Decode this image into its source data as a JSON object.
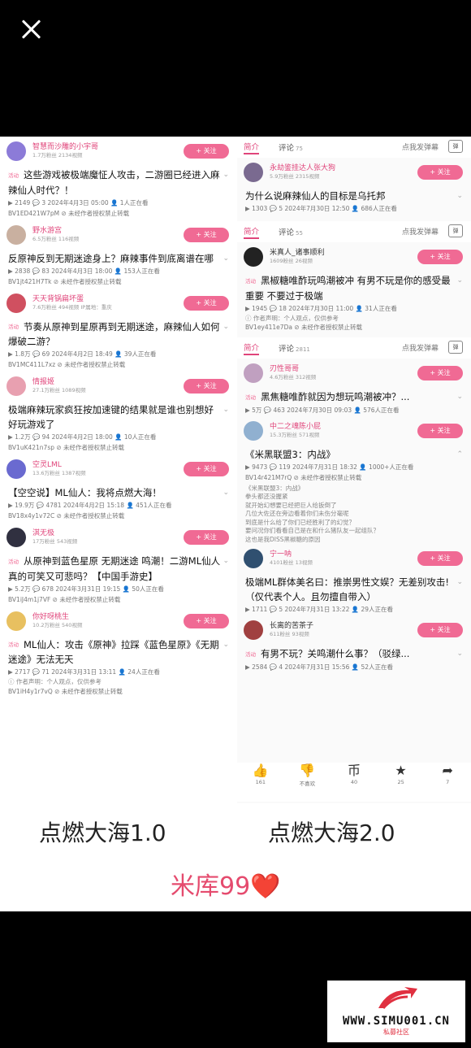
{
  "left": {
    "items": [
      {
        "author": "智慧而沙雕的小宇哥",
        "stat": "1.7万粉丝  2134视频",
        "follow": "+ 关注",
        "tag": "活动",
        "title": "这些游戏被极端魔怔人攻击，二游圈已经进入麻辣仙人时代？！",
        "meta": "▶ 2149  💬 3  2024年4月3日 05:00  👤 1人正在看",
        "bv": "BV1ED421W7pM  ⊘ 未经作者授权禁止转载",
        "avatar": "#8c7bd8"
      },
      {
        "author": "野水游宫",
        "stat": "6.5万粉丝  116视频",
        "follow": "+ 关注",
        "tag": "",
        "title": "反原神反到无期迷途身上？麻辣事件到底离谱在哪",
        "meta": "▶ 2838  💬 83  2024年4月3日 18:00  👤 153人正在看",
        "bv": "BV1jt421H7Tk  ⊘ 未经作者授权禁止转载",
        "avatar": "#c9b0a0"
      },
      {
        "author": "天天背锅扁坏蛋",
        "stat": "7.6万粉丝  494视频  IP属地：重庆",
        "follow": "+ 关注",
        "tag": "活动",
        "title": "节奏从原神到星原再到无期迷途，麻辣仙人如何爆破二游？",
        "meta": "▶ 1.8万  💬 69  2024年4月2日 18:49  👤 39人正在看",
        "bv": "BV1MC411L7xz  ⊘ 未经作者授权禁止转载",
        "avatar": "#d05060"
      },
      {
        "author": "情报姬",
        "stat": "27.1万粉丝  1089视频",
        "follow": "+ 关注",
        "tag": "",
        "title": "极端麻辣玩家疯狂按加速键的结果就是谁也别想好好玩游戏了",
        "meta": "▶ 1.2万  💬 94  2024年4月2日 18:00  👤 10人正在看",
        "bv": "BV1uK421n7sp  ⊘ 未经作者授权禁止转载",
        "avatar": "#e8a0b0"
      },
      {
        "author": "空灵LML",
        "stat": "13.6万粉丝  1387视频",
        "follow": "+ 关注",
        "tag": "",
        "title": "【空空说】ML仙人：我将点燃大海！",
        "meta": "▶ 19.9万  💬 4781  2024年4月2日 15:18  👤 451人正在看",
        "bv": "BV18x4y1v72C  ⊘ 未经作者授权禁止转载",
        "avatar": "#6a6ad0"
      },
      {
        "author": "淇无极",
        "stat": "17万粉丝  543视频",
        "follow": "+ 关注",
        "tag": "活动",
        "title": "从原神到蓝色星原 无期迷途 鸣潮！二游ML仙人真的可笑又可悲吗？【中国手游史】",
        "meta": "▶ 5.2万  💬 678  2024年3月31日 19:15  👤 50人正在看",
        "bv": "BV1iJ4m1j7VF  ⊘ 未经作者授权禁止转载",
        "avatar": "#303040"
      },
      {
        "author": "你好呀桃生",
        "stat": "10.2万粉丝  540视频",
        "follow": "+ 关注",
        "tag": "活动",
        "title": "ML仙人：攻击《原神》拉踩《蓝色星原》《无期迷途》无法无天",
        "meta": "▶ 2717  💬 71  2024年3月31日 13:11  👤 24人正在看",
        "desc": "ⓘ 作者声明：个人观点，仅供参考",
        "bv": "BV1iH4y1r7vQ  ⊘ 未经作者授权禁止转载",
        "avatar": "#e8c060"
      }
    ]
  },
  "right": {
    "tabs1": {
      "intro": "简介",
      "comments": "评论",
      "count": "75",
      "danmu": "点我发弹幕",
      "tv": "弹"
    },
    "item1": {
      "author": "永劫鉴挂达人张大狗",
      "stat": "5.9万粉丝  2315视频",
      "follow": "+ 关注",
      "title": "为什么说麻辣仙人的目标是乌托邦",
      "meta": "▶ 1303  💬 5  2024年7月30日 12:50  👤 686人正在看"
    },
    "tabs2": {
      "intro": "简介",
      "comments": "评论",
      "count": "55",
      "danmu": "点我发弹幕",
      "tv": "弹"
    },
    "item2": {
      "author": "米真人_诸事顺利",
      "stat": "1609粉丝  26视频",
      "follow": "+ 关注",
      "tag": "活动",
      "title": "黑椒糖唯酢玩鸣潮被冲 有男不玩是你的感受最重要 不要过于极端",
      "meta": "▶ 1945  💬 18  2024年7月30日 11:00  👤 31人正在看",
      "desc": "ⓘ 作者声明：个人观点，仅供参考",
      "bv": "BV1ey411e7Da  ⊘ 未经作者授权禁止转载"
    },
    "tabs3": {
      "intro": "简介",
      "comments": "评论",
      "count": "2811",
      "danmu": "点我发弹幕",
      "tv": "弹"
    },
    "item3": {
      "author": "刃性哥哥",
      "stat": "4.6万粉丝  312视频",
      "follow": "+ 关注",
      "tag": "活动",
      "title": "黑焦糖唯酢就因为想玩鸣潮被冲？...",
      "meta": "▶ 5万  💬 463  2024年7月30日 09:03  👤 576人正在看"
    },
    "item4": {
      "author": "中二之魂陈小屁",
      "stat": "15.3万粉丝  571视频",
      "follow": "+ 关注",
      "title": "《米黑联盟3：内战》",
      "meta": "▶ 9473  💬 119  2024年7月31日 18:32  👤 1000+人正在看",
      "bv": "BV14r421M7rQ  ⊘ 未经作者授权禁止转载",
      "desc": [
        "《米黑联盟3：内战》",
        "拳头都还没握紧",
        "就开始幻想要已经把巨人给扳倒了",
        "几位大佐还在旁边看着你们未伤分毫呢",
        "到底是什么给了你们已经胜利了的幻觉？",
        "要问况你们看看自己是在和什么猪队友一起组队？",
        "这也是我DISS黑椒糖的原因"
      ]
    },
    "item5": {
      "author": "宁一呐",
      "stat": "4101粉丝  13视频",
      "follow": "+ 关注",
      "title": "极端ML群体美名曰：推崇男性文娱？无差别攻击!（仅代表个人。且勿擅自带入）",
      "meta": "▶ 1711  💬 5  2024年7月31日 13:22  👤 29人正在看"
    },
    "item6": {
      "author": "长离的苦茶子",
      "stat": "611粉丝  93视频",
      "follow": "+ 关注",
      "tag": "活动",
      "title": "有男不玩？关鸣潮什么事？（驳绿...",
      "meta": "▶ 2584  💬 4  2024年7月31日 15:56  👤 52人正在看"
    },
    "actions": [
      {
        "icon": "👍",
        "label": "161"
      },
      {
        "icon": "👎",
        "label": "不喜欢"
      },
      {
        "icon": "币",
        "label": "40"
      },
      {
        "icon": "★",
        "label": "25"
      },
      {
        "icon": "➦",
        "label": "7"
      }
    ]
  },
  "captions": {
    "left": "点燃大海1.0",
    "right": "点燃大海2.0"
  },
  "brand": {
    "text": "米库99",
    "heart": "❤️"
  },
  "watermark": {
    "url": "WWW.SIMU001.CN",
    "sub": "私募社区"
  }
}
